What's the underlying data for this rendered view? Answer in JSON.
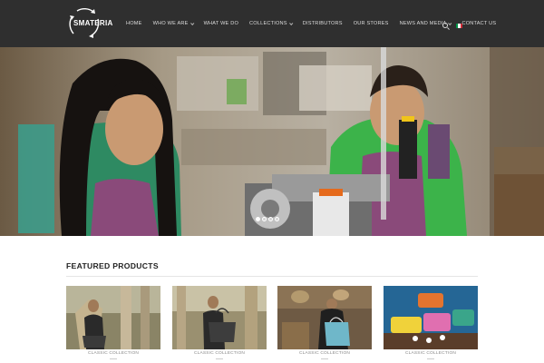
{
  "brand": {
    "logo_text": "SMATERIA"
  },
  "nav": {
    "items": [
      {
        "label": "HOME",
        "dropdown": false
      },
      {
        "label": "WHO WE ARE",
        "dropdown": true
      },
      {
        "label": "WHAT WE DO",
        "dropdown": false
      },
      {
        "label": "COLLECTIONS",
        "dropdown": true
      },
      {
        "label": "DISTRIBUTORS",
        "dropdown": false
      },
      {
        "label": "OUR STORES",
        "dropdown": false
      },
      {
        "label": "NEWS AND MEDIA",
        "dropdown": true
      },
      {
        "label": "CONTACT US",
        "dropdown": false
      }
    ],
    "search_icon": "search-icon",
    "language_flag_colors": [
      "#009246",
      "#ffffff",
      "#ce2b37"
    ]
  },
  "hero": {
    "slides_count": 4,
    "active_slide": 1
  },
  "featured": {
    "title": "FEATURED PRODUCTS",
    "products": [
      {
        "caption": "CLASSIC COLLECTION"
      },
      {
        "caption": "CLASSIC COLLECTION"
      },
      {
        "caption": "CLASSIC COLLECTION"
      },
      {
        "caption": "CLASSIC COLLECTION"
      }
    ]
  },
  "colors": {
    "header_bg": "#2f2f2f",
    "nav_text": "#dcdcdc"
  }
}
